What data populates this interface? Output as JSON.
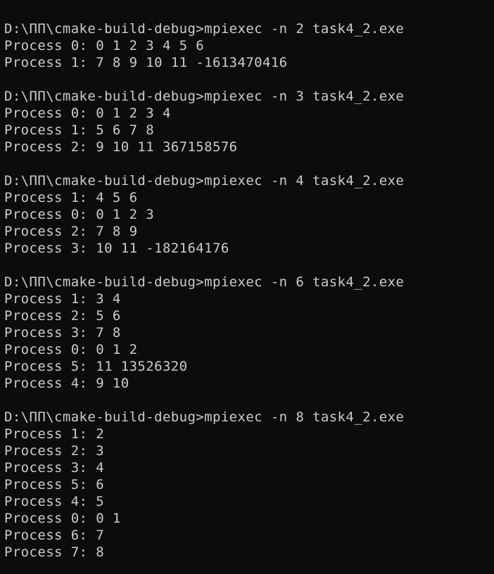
{
  "terminal": {
    "background": "#0c0c0c",
    "foreground": "#cccccc",
    "blocks": [
      {
        "command": "D:\\ПП\\cmake-build-debug>mpiexec -n 2 task4_2.exe",
        "output": [
          "Process 0: 0 1 2 3 4 5 6",
          "Process 1: 7 8 9 10 11 -1613470416"
        ]
      },
      {
        "command": "D:\\ПП\\cmake-build-debug>mpiexec -n 3 task4_2.exe",
        "output": [
          "Process 0: 0 1 2 3 4",
          "Process 1: 5 6 7 8",
          "Process 2: 9 10 11 367158576"
        ]
      },
      {
        "command": "D:\\ПП\\cmake-build-debug>mpiexec -n 4 task4_2.exe",
        "output": [
          "Process 1: 4 5 6",
          "Process 0: 0 1 2 3",
          "Process 2: 7 8 9",
          "Process 3: 10 11 -182164176"
        ]
      },
      {
        "command": "D:\\ПП\\cmake-build-debug>mpiexec -n 6 task4_2.exe",
        "output": [
          "Process 1: 3 4",
          "Process 2: 5 6",
          "Process 3: 7 8",
          "Process 0: 0 1 2",
          "Process 5: 11 13526320",
          "Process 4: 9 10"
        ]
      },
      {
        "command": "D:\\ПП\\cmake-build-debug>mpiexec -n 8 task4_2.exe",
        "output": [
          "Process 1: 2",
          "Process 2: 3",
          "Process 3: 4",
          "Process 5: 6",
          "Process 4: 5",
          "Process 0: 0 1",
          "Process 6: 7",
          "Process 7: 8"
        ]
      }
    ]
  }
}
